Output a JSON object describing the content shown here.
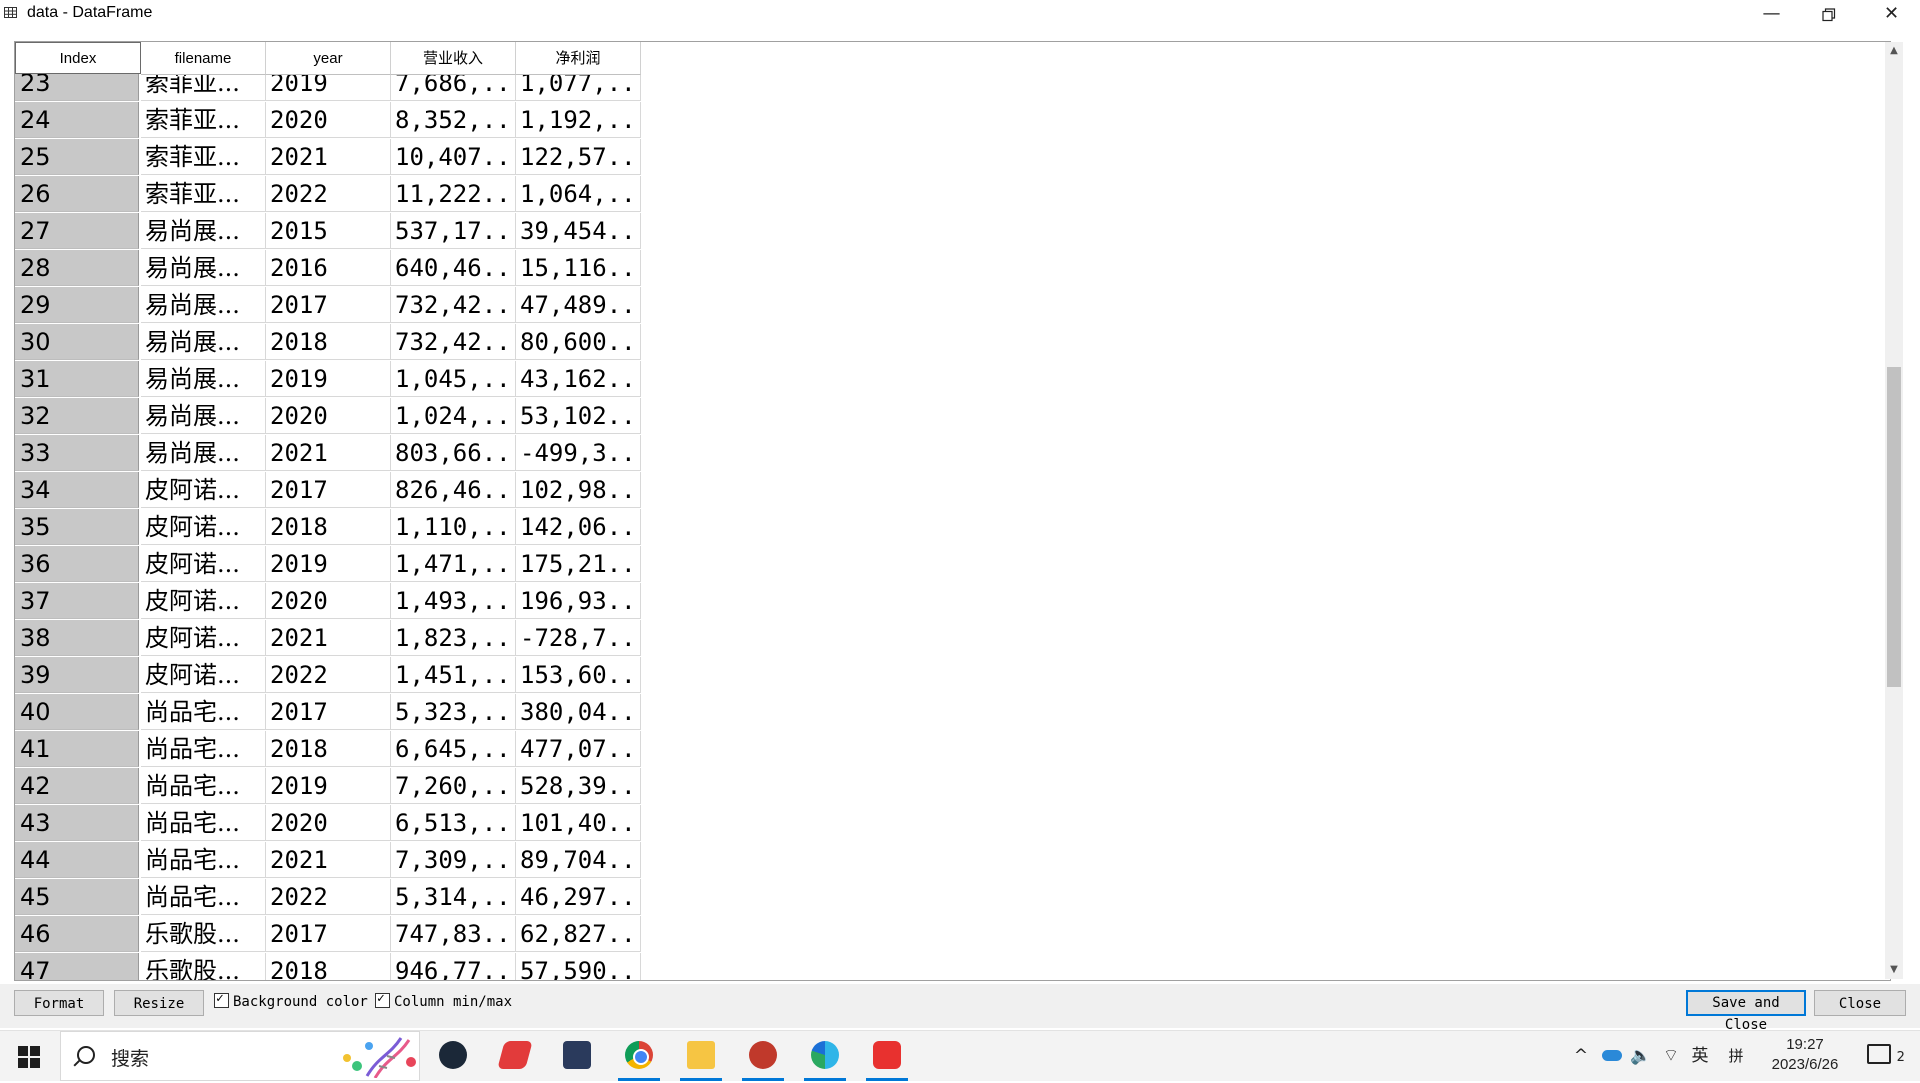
{
  "window": {
    "title": "data - DataFrame"
  },
  "table": {
    "columns": [
      "Index",
      "filename",
      "year",
      "营业收入",
      "净利润"
    ],
    "rows": [
      {
        "index": "23",
        "filename": "索菲亚...",
        "year": "2019",
        "revenue": "7,686,...",
        "profit": "1,077,..."
      },
      {
        "index": "24",
        "filename": "索菲亚...",
        "year": "2020",
        "revenue": "8,352,...",
        "profit": "1,192,..."
      },
      {
        "index": "25",
        "filename": "索菲亚...",
        "year": "2021",
        "revenue": "10,407...",
        "profit": "122,57..."
      },
      {
        "index": "26",
        "filename": "索菲亚...",
        "year": "2022",
        "revenue": "11,222...",
        "profit": "1,064,..."
      },
      {
        "index": "27",
        "filename": "易尚展...",
        "year": "2015",
        "revenue": "537,17...",
        "profit": "39,454..."
      },
      {
        "index": "28",
        "filename": "易尚展...",
        "year": "2016",
        "revenue": "640,46...",
        "profit": "15,116..."
      },
      {
        "index": "29",
        "filename": "易尚展...",
        "year": "2017",
        "revenue": "732,42...",
        "profit": "47,489..."
      },
      {
        "index": "30",
        "filename": "易尚展...",
        "year": "2018",
        "revenue": "732,42...",
        "profit": "80,600..."
      },
      {
        "index": "31",
        "filename": "易尚展...",
        "year": "2019",
        "revenue": "1,045,...",
        "profit": "43,162..."
      },
      {
        "index": "32",
        "filename": "易尚展...",
        "year": "2020",
        "revenue": "1,024,...",
        "profit": "53,102..."
      },
      {
        "index": "33",
        "filename": "易尚展...",
        "year": "2021",
        "revenue": "803,66...",
        "profit": "-499,3..."
      },
      {
        "index": "34",
        "filename": "皮阿诺...",
        "year": "2017",
        "revenue": "826,46...",
        "profit": "102,98..."
      },
      {
        "index": "35",
        "filename": "皮阿诺...",
        "year": "2018",
        "revenue": "1,110,...",
        "profit": "142,06..."
      },
      {
        "index": "36",
        "filename": "皮阿诺...",
        "year": "2019",
        "revenue": "1,471,...",
        "profit": "175,21..."
      },
      {
        "index": "37",
        "filename": "皮阿诺...",
        "year": "2020",
        "revenue": "1,493,...",
        "profit": "196,93..."
      },
      {
        "index": "38",
        "filename": "皮阿诺...",
        "year": "2021",
        "revenue": "1,823,...",
        "profit": "-728,7..."
      },
      {
        "index": "39",
        "filename": "皮阿诺...",
        "year": "2022",
        "revenue": "1,451,...",
        "profit": "153,60..."
      },
      {
        "index": "40",
        "filename": "尚品宅...",
        "year": "2017",
        "revenue": "5,323,...",
        "profit": "380,04..."
      },
      {
        "index": "41",
        "filename": "尚品宅...",
        "year": "2018",
        "revenue": "6,645,...",
        "profit": "477,07..."
      },
      {
        "index": "42",
        "filename": "尚品宅...",
        "year": "2019",
        "revenue": "7,260,...",
        "profit": "528,39..."
      },
      {
        "index": "43",
        "filename": "尚品宅...",
        "year": "2020",
        "revenue": "6,513,...",
        "profit": "101,40..."
      },
      {
        "index": "44",
        "filename": "尚品宅...",
        "year": "2021",
        "revenue": "7,309,...",
        "profit": "89,704..."
      },
      {
        "index": "45",
        "filename": "尚品宅...",
        "year": "2022",
        "revenue": "5,314,...",
        "profit": "46,297..."
      },
      {
        "index": "46",
        "filename": "乐歌股...",
        "year": "2017",
        "revenue": "747,83...",
        "profit": "62,827..."
      },
      {
        "index": "47",
        "filename": "乐歌股...",
        "year": "2018",
        "revenue": "946,77...",
        "profit": "57,590..."
      }
    ]
  },
  "controls": {
    "format_label": "Format",
    "resize_label": "Resize",
    "bg_color_label": "Background color",
    "col_minmax_label": "Column min/max",
    "save_close_label": "Save and Close",
    "close_label": "Close"
  },
  "taskbar": {
    "search_text": "搜索",
    "tray_lang": "英",
    "tray_ime": "拼",
    "time": "19:27",
    "date": "2023/6/26",
    "notif_count": "2"
  },
  "colors": {
    "accent": "#0078d7",
    "index_bg": "#c8c8c8"
  }
}
